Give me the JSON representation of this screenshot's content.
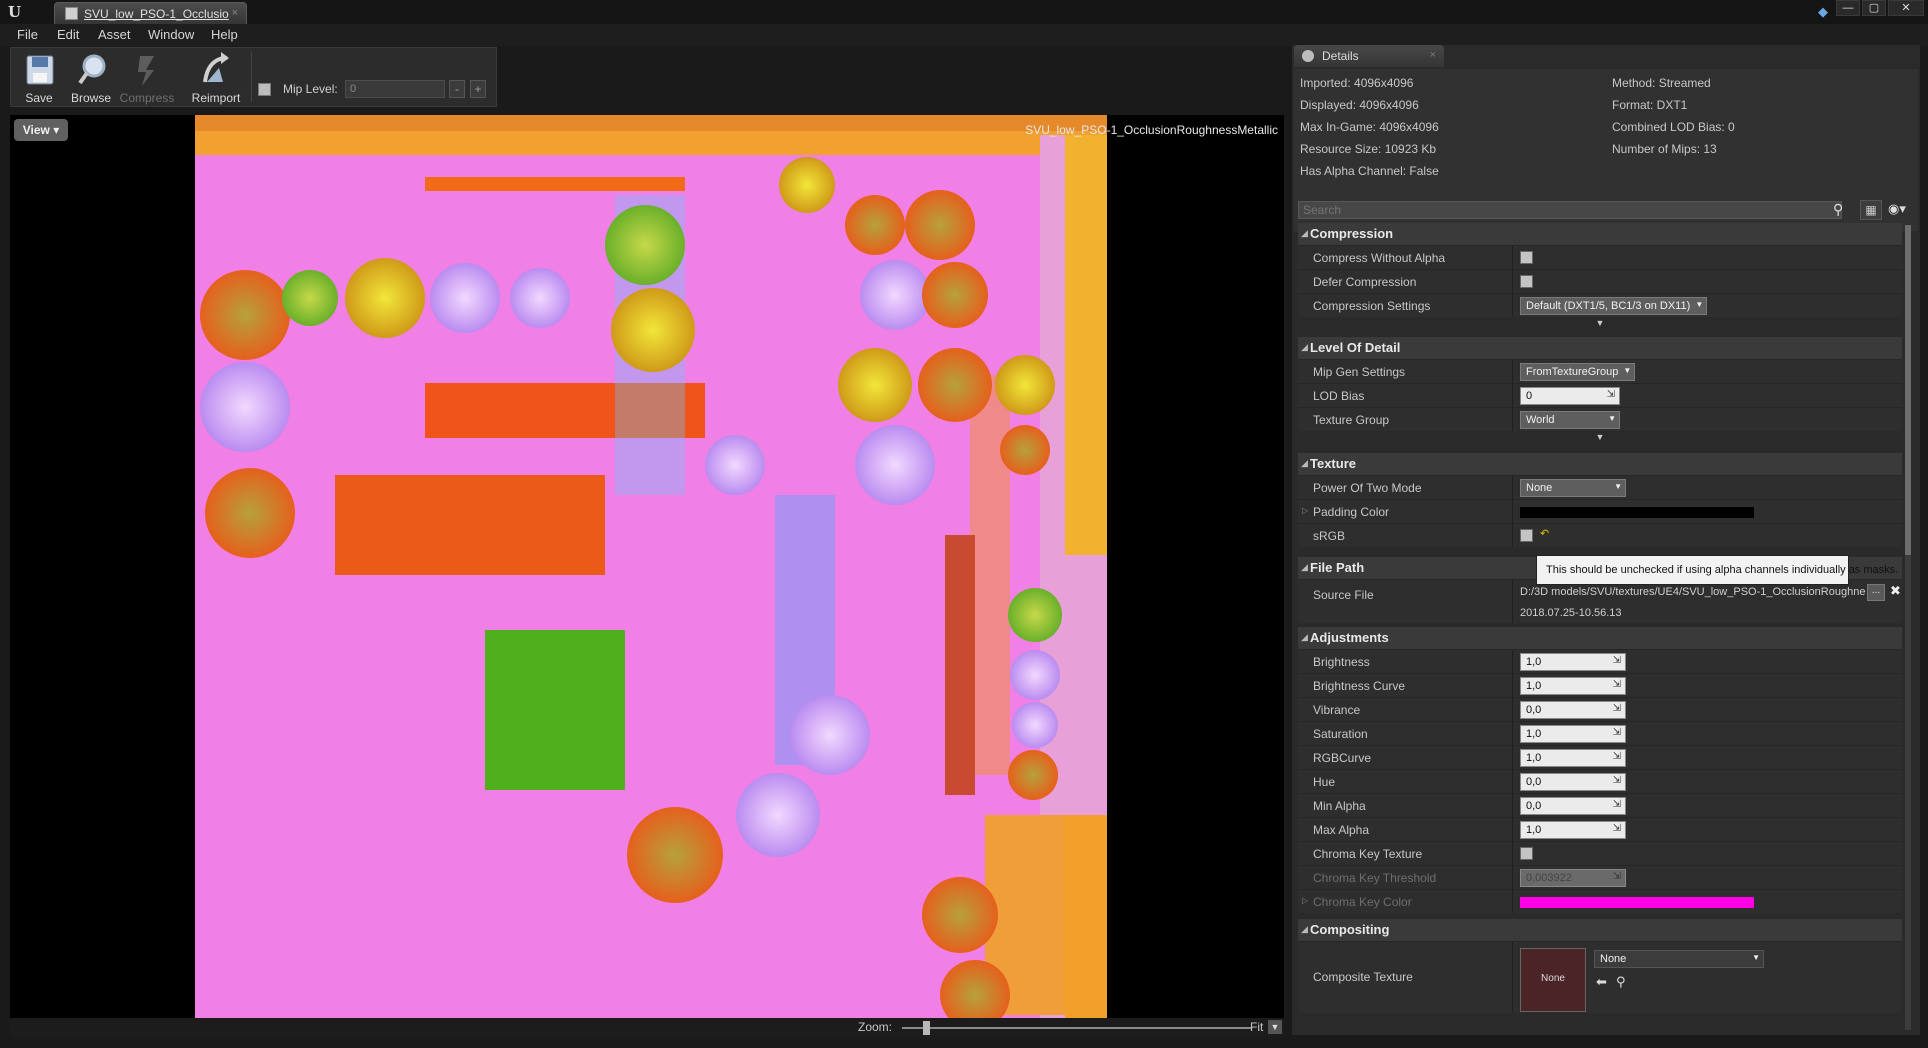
{
  "window": {
    "tab_title": "SVU_low_PSO-1_Occlusio",
    "tab_close": "×",
    "minimize": "—",
    "maximize": "▢",
    "close": "✕"
  },
  "menu": [
    "File",
    "Edit",
    "Asset",
    "Window",
    "Help"
  ],
  "toolbar": {
    "save": "Save",
    "browse": "Browse",
    "compress": "Compress",
    "reimport": "Reimport",
    "mip_level_label": "Mip Level:",
    "mip_level_value": "0",
    "mip_minus": "-",
    "mip_plus": "+"
  },
  "viewport": {
    "view_button": "View ▾",
    "texture_name": "SVU_low_PSO-1_OcclusionRoughnessMetallic",
    "zoom_label": "Zoom:",
    "zoom_value": "Fit",
    "zoom_fraction": 0.06
  },
  "details": {
    "tab_label": "Details",
    "info_left": [
      "Imported: 4096x4096",
      "Displayed: 4096x4096",
      "Max In-Game: 4096x4096",
      "Resource Size: 10923 Kb",
      "Has Alpha Channel: False"
    ],
    "info_right": [
      "Method: Streamed",
      "Format: DXT1",
      "Combined LOD Bias: 0",
      "Number of Mips: 13"
    ],
    "search_placeholder": "Search",
    "categories": {
      "compression": "Compression",
      "lod": "Level Of Detail",
      "texture": "Texture",
      "file_path": "File Path",
      "adjustments": "Adjustments",
      "compositing": "Compositing"
    },
    "compression": {
      "compress_without_alpha": "Compress Without Alpha",
      "defer_compression": "Defer Compression",
      "compression_settings": "Compression Settings",
      "compression_settings_value": "Default (DXT1/5, BC1/3 on DX11)"
    },
    "lod": {
      "mip_gen_settings": "Mip Gen Settings",
      "mip_gen_settings_value": "FromTextureGroup",
      "lod_bias": "LOD Bias",
      "lod_bias_value": "0",
      "texture_group": "Texture Group",
      "texture_group_value": "World"
    },
    "texture": {
      "power_of_two_mode": "Power Of Two Mode",
      "power_of_two_mode_value": "None",
      "padding_color": "Padding Color",
      "padding_color_hex": "#000000",
      "srgb": "sRGB"
    },
    "file_path": {
      "source_file": "Source File",
      "source_file_value": "D:/3D models/SVU/textures/UE4/SVU_low_PSO-1_OcclusionRoughne",
      "source_file_timestamp": "2018.07.25-10.56.13",
      "browse_button": "..."
    },
    "adjustments": [
      {
        "label": "Brightness",
        "value": "1,0"
      },
      {
        "label": "Brightness Curve",
        "value": "1,0"
      },
      {
        "label": "Vibrance",
        "value": "0,0"
      },
      {
        "label": "Saturation",
        "value": "1,0"
      },
      {
        "label": "RGBCurve",
        "value": "1,0"
      },
      {
        "label": "Hue",
        "value": "0,0"
      },
      {
        "label": "Min Alpha",
        "value": "0,0"
      },
      {
        "label": "Max Alpha",
        "value": "1,0"
      }
    ],
    "chroma": {
      "chroma_key_texture": "Chroma Key Texture",
      "chroma_key_threshold": "Chroma Key Threshold",
      "chroma_key_threshold_value": "0,003922",
      "chroma_key_color": "Chroma Key Color",
      "chroma_key_color_hex": "#ff00ff"
    },
    "compositing": {
      "composite_texture": "Composite Texture",
      "thumbnail_label": "None",
      "dropdown_value": "None"
    },
    "tooltip": "This should be unchecked if using alpha channels individually as masks."
  }
}
